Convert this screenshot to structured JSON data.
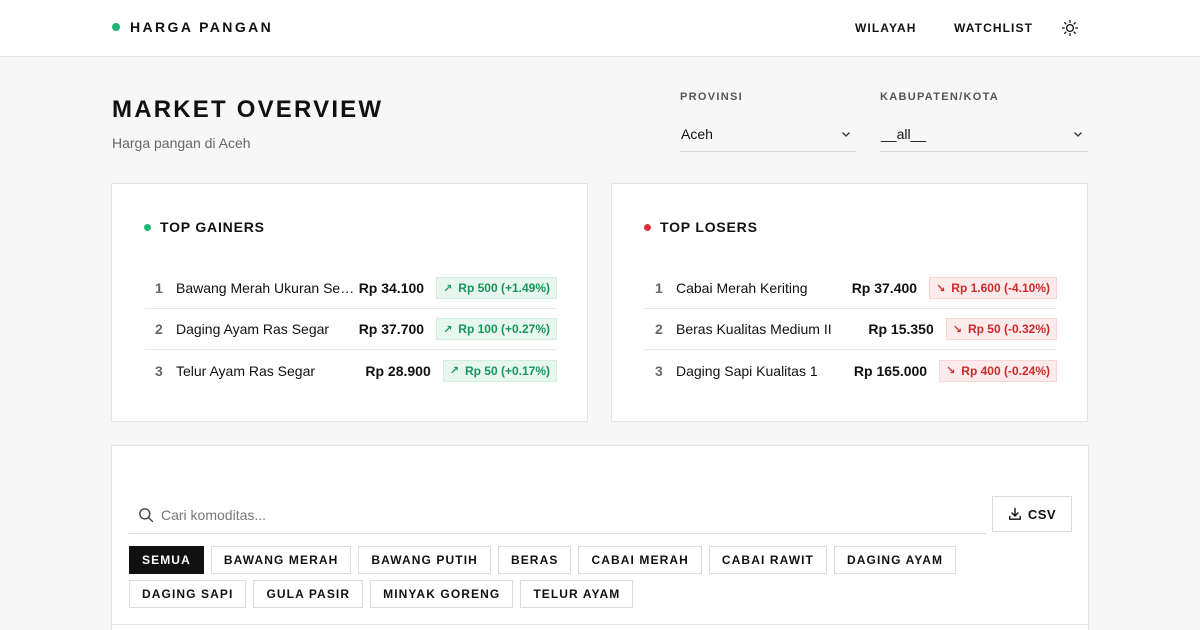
{
  "brand": {
    "name": "HARGA PANGAN",
    "dot_color": "#1fb574"
  },
  "nav": {
    "wilayah": "WILAYAH",
    "watchlist": "WATCHLIST",
    "theme_icon": "sun-icon"
  },
  "header": {
    "title": "MARKET OVERVIEW",
    "subtitle": "Harga pangan di Aceh"
  },
  "filters": {
    "provinsi": {
      "label": "PROVINSI",
      "value": "Aceh"
    },
    "kabupaten": {
      "label": "KABUPATEN/KOTA",
      "value": "__all__"
    }
  },
  "gainers": {
    "title": "TOP GAINERS",
    "dot_color": "#1fb574",
    "items": [
      {
        "rank": "1",
        "name": "Bawang Merah Ukuran Sedang",
        "price": "Rp 34.100",
        "change": "Rp 500 (+1.49%)"
      },
      {
        "rank": "2",
        "name": "Daging Ayam Ras Segar",
        "price": "Rp 37.700",
        "change": "Rp 100 (+0.27%)"
      },
      {
        "rank": "3",
        "name": "Telur Ayam Ras Segar",
        "price": "Rp 28.900",
        "change": "Rp 50 (+0.17%)"
      }
    ]
  },
  "losers": {
    "title": "TOP LOSERS",
    "dot_color": "#e0313a",
    "items": [
      {
        "rank": "1",
        "name": "Cabai Merah Keriting",
        "price": "Rp 37.400",
        "change": "Rp 1.600 (-4.10%)"
      },
      {
        "rank": "2",
        "name": "Beras Kualitas Medium II",
        "price": "Rp 15.350",
        "change": "Rp 50 (-0.32%)"
      },
      {
        "rank": "3",
        "name": "Daging Sapi Kualitas 1",
        "price": "Rp 165.000",
        "change": "Rp 400 (-0.24%)"
      }
    ]
  },
  "commodities": {
    "search_placeholder": "Cari komoditas...",
    "csv_label": "CSV",
    "categories": [
      "SEMUA",
      "BAWANG MERAH",
      "BAWANG PUTIH",
      "BERAS",
      "CABAI MERAH",
      "CABAI RAWIT",
      "DAGING AYAM",
      "DAGING SAPI",
      "GULA PASIR",
      "MINYAK GORENG",
      "TELUR AYAM"
    ],
    "active_category": "SEMUA"
  }
}
